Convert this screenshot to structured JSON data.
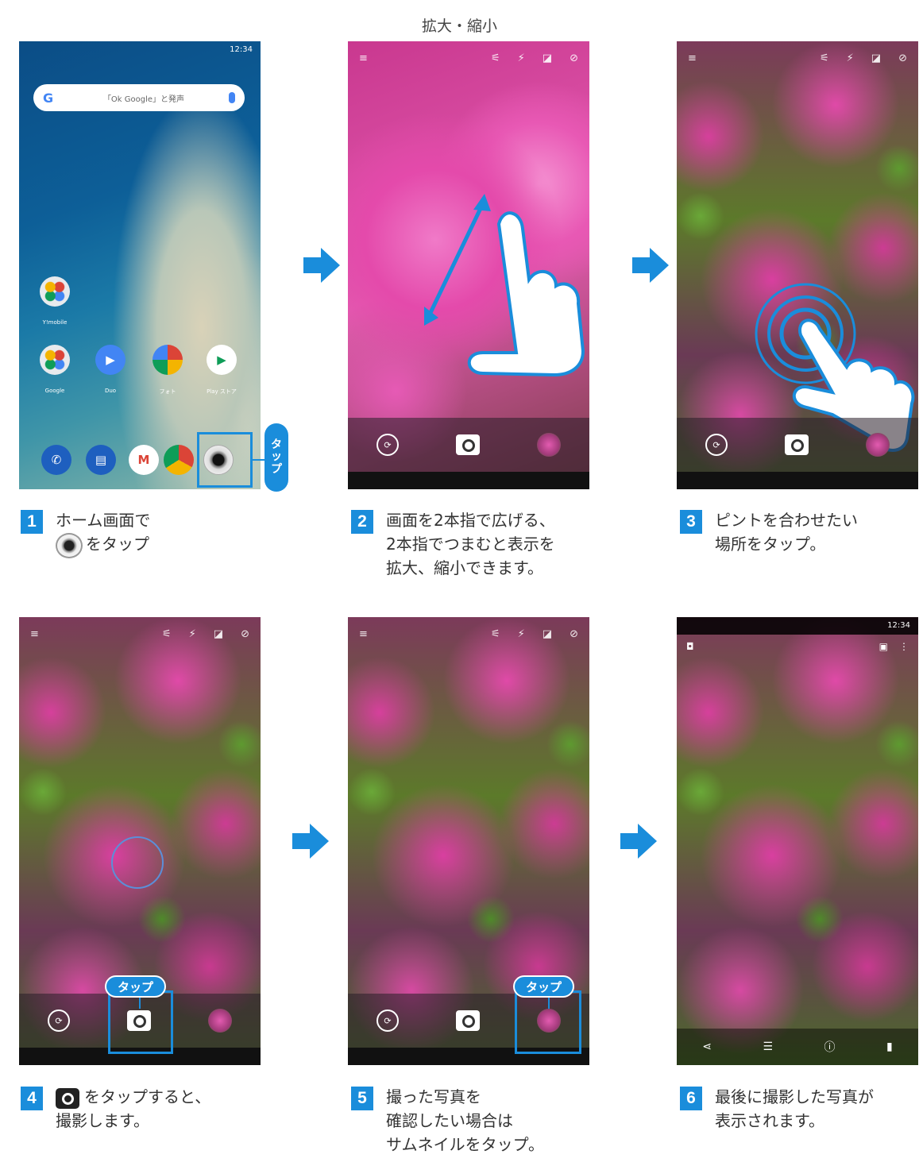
{
  "header": {
    "title": "拡大・縮小"
  },
  "home": {
    "status_time": "12:34",
    "search_placeholder": "「Ok Google」と発声",
    "apps": [
      {
        "label": "Y!mobile"
      },
      {
        "label": "Google"
      },
      {
        "label": "Duo"
      },
      {
        "label": "フォト"
      },
      {
        "label": "Play ストア"
      }
    ],
    "tap_tag": [
      "タ",
      "ッ",
      "プ"
    ]
  },
  "viewer": {
    "status_time": "12:34"
  },
  "tags": {
    "tap": "タップ"
  },
  "colors": {
    "accent": "#1a8ddb",
    "flower": "#e04aa8"
  },
  "steps": [
    {
      "num": "1",
      "lines": [
        "ホーム画面で",
        "をタップ"
      ]
    },
    {
      "num": "2",
      "lines": [
        "画面を2本指で広げる、",
        "2本指でつまむと表示を",
        "拡大、縮小できます。"
      ]
    },
    {
      "num": "3",
      "lines": [
        "ピントを合わせたい",
        "場所をタップ。"
      ]
    },
    {
      "num": "4",
      "lines": [
        "をタップすると、",
        "撮影します。"
      ]
    },
    {
      "num": "5",
      "lines": [
        "撮った写真を",
        "確認したい場合は",
        "サムネイルをタップ。"
      ]
    },
    {
      "num": "6",
      "lines": [
        "最後に撮影した写真が",
        "表示されます。"
      ]
    }
  ]
}
